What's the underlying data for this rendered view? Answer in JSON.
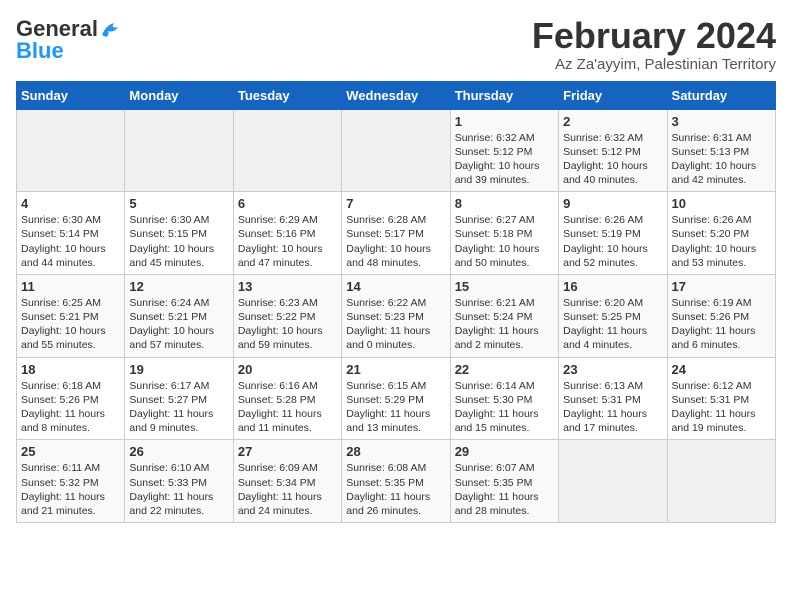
{
  "header": {
    "logo_general": "General",
    "logo_blue": "Blue",
    "title": "February 2024",
    "subtitle": "Az Za'ayyim, Palestinian Territory"
  },
  "weekdays": [
    "Sunday",
    "Monday",
    "Tuesday",
    "Wednesday",
    "Thursday",
    "Friday",
    "Saturday"
  ],
  "weeks": [
    [
      {
        "day": "",
        "sunrise": "",
        "sunset": "",
        "daylight": ""
      },
      {
        "day": "",
        "sunrise": "",
        "sunset": "",
        "daylight": ""
      },
      {
        "day": "",
        "sunrise": "",
        "sunset": "",
        "daylight": ""
      },
      {
        "day": "",
        "sunrise": "",
        "sunset": "",
        "daylight": ""
      },
      {
        "day": "1",
        "sunrise": "Sunrise: 6:32 AM",
        "sunset": "Sunset: 5:12 PM",
        "daylight": "Daylight: 10 hours and 39 minutes."
      },
      {
        "day": "2",
        "sunrise": "Sunrise: 6:32 AM",
        "sunset": "Sunset: 5:12 PM",
        "daylight": "Daylight: 10 hours and 40 minutes."
      },
      {
        "day": "3",
        "sunrise": "Sunrise: 6:31 AM",
        "sunset": "Sunset: 5:13 PM",
        "daylight": "Daylight: 10 hours and 42 minutes."
      }
    ],
    [
      {
        "day": "4",
        "sunrise": "Sunrise: 6:30 AM",
        "sunset": "Sunset: 5:14 PM",
        "daylight": "Daylight: 10 hours and 44 minutes."
      },
      {
        "day": "5",
        "sunrise": "Sunrise: 6:30 AM",
        "sunset": "Sunset: 5:15 PM",
        "daylight": "Daylight: 10 hours and 45 minutes."
      },
      {
        "day": "6",
        "sunrise": "Sunrise: 6:29 AM",
        "sunset": "Sunset: 5:16 PM",
        "daylight": "Daylight: 10 hours and 47 minutes."
      },
      {
        "day": "7",
        "sunrise": "Sunrise: 6:28 AM",
        "sunset": "Sunset: 5:17 PM",
        "daylight": "Daylight: 10 hours and 48 minutes."
      },
      {
        "day": "8",
        "sunrise": "Sunrise: 6:27 AM",
        "sunset": "Sunset: 5:18 PM",
        "daylight": "Daylight: 10 hours and 50 minutes."
      },
      {
        "day": "9",
        "sunrise": "Sunrise: 6:26 AM",
        "sunset": "Sunset: 5:19 PM",
        "daylight": "Daylight: 10 hours and 52 minutes."
      },
      {
        "day": "10",
        "sunrise": "Sunrise: 6:26 AM",
        "sunset": "Sunset: 5:20 PM",
        "daylight": "Daylight: 10 hours and 53 minutes."
      }
    ],
    [
      {
        "day": "11",
        "sunrise": "Sunrise: 6:25 AM",
        "sunset": "Sunset: 5:21 PM",
        "daylight": "Daylight: 10 hours and 55 minutes."
      },
      {
        "day": "12",
        "sunrise": "Sunrise: 6:24 AM",
        "sunset": "Sunset: 5:21 PM",
        "daylight": "Daylight: 10 hours and 57 minutes."
      },
      {
        "day": "13",
        "sunrise": "Sunrise: 6:23 AM",
        "sunset": "Sunset: 5:22 PM",
        "daylight": "Daylight: 10 hours and 59 minutes."
      },
      {
        "day": "14",
        "sunrise": "Sunrise: 6:22 AM",
        "sunset": "Sunset: 5:23 PM",
        "daylight": "Daylight: 11 hours and 0 minutes."
      },
      {
        "day": "15",
        "sunrise": "Sunrise: 6:21 AM",
        "sunset": "Sunset: 5:24 PM",
        "daylight": "Daylight: 11 hours and 2 minutes."
      },
      {
        "day": "16",
        "sunrise": "Sunrise: 6:20 AM",
        "sunset": "Sunset: 5:25 PM",
        "daylight": "Daylight: 11 hours and 4 minutes."
      },
      {
        "day": "17",
        "sunrise": "Sunrise: 6:19 AM",
        "sunset": "Sunset: 5:26 PM",
        "daylight": "Daylight: 11 hours and 6 minutes."
      }
    ],
    [
      {
        "day": "18",
        "sunrise": "Sunrise: 6:18 AM",
        "sunset": "Sunset: 5:26 PM",
        "daylight": "Daylight: 11 hours and 8 minutes."
      },
      {
        "day": "19",
        "sunrise": "Sunrise: 6:17 AM",
        "sunset": "Sunset: 5:27 PM",
        "daylight": "Daylight: 11 hours and 9 minutes."
      },
      {
        "day": "20",
        "sunrise": "Sunrise: 6:16 AM",
        "sunset": "Sunset: 5:28 PM",
        "daylight": "Daylight: 11 hours and 11 minutes."
      },
      {
        "day": "21",
        "sunrise": "Sunrise: 6:15 AM",
        "sunset": "Sunset: 5:29 PM",
        "daylight": "Daylight: 11 hours and 13 minutes."
      },
      {
        "day": "22",
        "sunrise": "Sunrise: 6:14 AM",
        "sunset": "Sunset: 5:30 PM",
        "daylight": "Daylight: 11 hours and 15 minutes."
      },
      {
        "day": "23",
        "sunrise": "Sunrise: 6:13 AM",
        "sunset": "Sunset: 5:31 PM",
        "daylight": "Daylight: 11 hours and 17 minutes."
      },
      {
        "day": "24",
        "sunrise": "Sunrise: 6:12 AM",
        "sunset": "Sunset: 5:31 PM",
        "daylight": "Daylight: 11 hours and 19 minutes."
      }
    ],
    [
      {
        "day": "25",
        "sunrise": "Sunrise: 6:11 AM",
        "sunset": "Sunset: 5:32 PM",
        "daylight": "Daylight: 11 hours and 21 minutes."
      },
      {
        "day": "26",
        "sunrise": "Sunrise: 6:10 AM",
        "sunset": "Sunset: 5:33 PM",
        "daylight": "Daylight: 11 hours and 22 minutes."
      },
      {
        "day": "27",
        "sunrise": "Sunrise: 6:09 AM",
        "sunset": "Sunset: 5:34 PM",
        "daylight": "Daylight: 11 hours and 24 minutes."
      },
      {
        "day": "28",
        "sunrise": "Sunrise: 6:08 AM",
        "sunset": "Sunset: 5:35 PM",
        "daylight": "Daylight: 11 hours and 26 minutes."
      },
      {
        "day": "29",
        "sunrise": "Sunrise: 6:07 AM",
        "sunset": "Sunset: 5:35 PM",
        "daylight": "Daylight: 11 hours and 28 minutes."
      },
      {
        "day": "",
        "sunrise": "",
        "sunset": "",
        "daylight": ""
      },
      {
        "day": "",
        "sunrise": "",
        "sunset": "",
        "daylight": ""
      }
    ]
  ]
}
